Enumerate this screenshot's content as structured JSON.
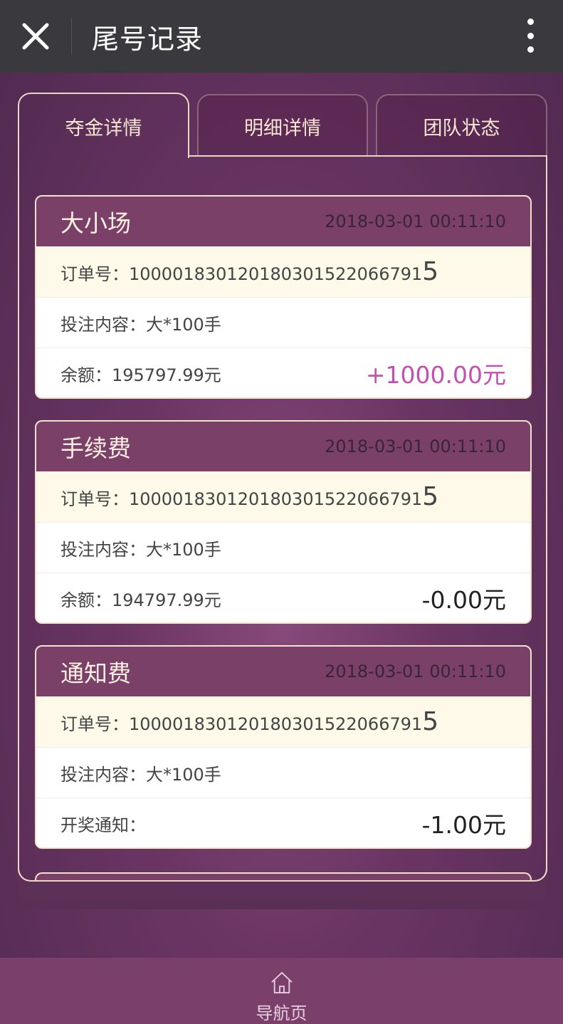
{
  "header": {
    "title": "尾号记录",
    "close_icon": "close-icon",
    "more_icon": "more-vertical-icon"
  },
  "tabs": [
    {
      "label": "夺金详情",
      "active": true
    },
    {
      "label": "明细详情",
      "active": false
    },
    {
      "label": "团队状态",
      "active": false
    }
  ],
  "cards": [
    {
      "name": "大小场",
      "time": "2018-03-01 00:11:10",
      "order_label": "订单号：",
      "order_main": "10000183012018030152206679 1",
      "order_last": "5",
      "content_label": "投注内容：",
      "content_value": "大*100手",
      "bottom_label": "余额：",
      "bottom_value": "195797.99元",
      "amount": "+1000.00元"
    },
    {
      "name": "手续费",
      "time": "2018-03-01 00:11:10",
      "order_label": "订单号：",
      "order_main": "10000183012018030152206679 1",
      "order_last": "5",
      "content_label": "投注内容：",
      "content_value": "大*100手",
      "bottom_label": "余额：",
      "bottom_value": "194797.99元",
      "amount": "-0.00元"
    },
    {
      "name": "通知费",
      "time": "2018-03-01 00:11:10",
      "order_label": "订单号：",
      "order_main": "10000183012018030152206679 1",
      "order_last": "5",
      "content_label": "投注内容：",
      "content_value": "大*100手",
      "bottom_label": "开奖通知：",
      "bottom_value": "",
      "amount": "-1.00元"
    }
  ],
  "bottom_nav": {
    "label": "导航页",
    "icon": "home-icon"
  },
  "colors": {
    "accent_positive": "#c44fb3",
    "card_header": "#7b4067",
    "order_row": "#fef9e8"
  }
}
